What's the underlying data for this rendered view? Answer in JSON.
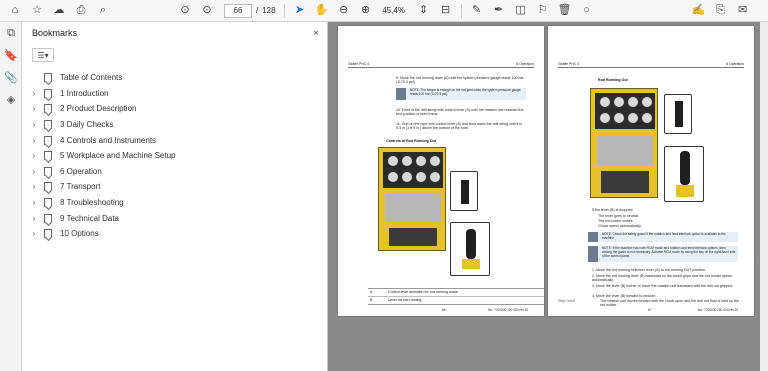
{
  "toolbar": {
    "page_current": "66",
    "page_sep": "/",
    "page_total": "128",
    "zoom": "45,4%"
  },
  "panel": {
    "title": "Bookmarks",
    "close": "×",
    "options": "☰▾"
  },
  "bookmarks": [
    {
      "label": "Table of Contents",
      "has_children": false
    },
    {
      "label": "1 Introduction",
      "has_children": true
    },
    {
      "label": "2 Product Description",
      "has_children": true
    },
    {
      "label": "3 Daily Checks",
      "has_children": true
    },
    {
      "label": "4 Controls and Instruments",
      "has_children": true
    },
    {
      "label": "5 Workplace and Machine Setup",
      "has_children": true
    },
    {
      "label": "6 Operation",
      "has_children": true
    },
    {
      "label": "7 Transport",
      "has_children": true
    },
    {
      "label": "8 Troubleshooting",
      "has_children": true
    },
    {
      "label": "9 Technical Data",
      "has_children": true
    },
    {
      "label": "10 Options",
      "has_children": true
    }
  ],
  "pages": {
    "left": {
      "header_left": "Giraffe PHC 4",
      "header_right": "8 Operation",
      "step9": "9.    Move the rod running lever (A) until the system pressure gauge reads 100 bar (1170 3 psi).",
      "note1": "NOTE: The torque is enough on the rod joint when the system pressure gauge reads 100 bar (1170 3 psi).",
      "step10": "10.   Feed in the drill string with control lever (A) until the rotation has reached the end position of feed frame.",
      "step11": "11.   Grip on the pipe with control lever (A) and feed down the drill string until it is 0.3 m (1 ft 0 in.) above the bottom of the hole.",
      "figure_title": "Controls of Rod Running Out",
      "legend_a_key": "A",
      "legend_a_text": "Control lever selection for rod running mode.",
      "legend_b_key": "B",
      "legend_b_text": "Lever for rod running",
      "footer_page": "66",
      "footer_doc": "No: ??00000 000 000 rev.10"
    },
    "right": {
      "header_left": "Giraffe PHC 4",
      "header_right": "8 Operation",
      "section_title": "Rod Running Out",
      "lever_text": "If the lever (B) is dropped:",
      "b1": "The lever goes to neutral.",
      "b2": "The rod holder closes.",
      "b3": "Chuck opens automatically.",
      "note2": "NOTE: Check the safety guard if the rotation and feed interlock option is available in the machine.",
      "note3": "NOTE: If the machine has both RCM mode and rotation and feed interlock options, then closing the guard is not necessary. Activate RCM mode by using the key on the right-hand side of the control panel.",
      "s1": "1.   Move the rod running selection lever (A) to rod running OUT position.",
      "s2": "2.   Move the rod running lever (B) backward so the chuck grips and the rod holder opens automatically.",
      "s3": "3.   Move the lever (B) further to move the rotation unit backward with the drill rod gripped.",
      "s4": "4.   Move the lever (B) forward to reclude.",
      "side": "Step result",
      "s4b": "The rotation unit moves forward with the chuck open and the drill rod fluid is held by the rod holder.",
      "footer_page": "67",
      "footer_doc": "No: ??00000 000 000 rev.10"
    }
  },
  "icons": [
    "home-icon",
    "star-icon",
    "upload-icon",
    "print-icon",
    "zoom-search-icon",
    "prev-page-icon",
    "next-page-icon",
    "select-cursor-icon",
    "hand-icon",
    "zoom-out-icon",
    "zoom-in-icon",
    "fit-icon",
    "scroll-mode-icon",
    "comment-icon",
    "pen-icon",
    "highlight-icon",
    "stamp-icon",
    "delete-icon",
    "protect-icon",
    "sign-icon",
    "share-icon",
    "mail-icon"
  ]
}
